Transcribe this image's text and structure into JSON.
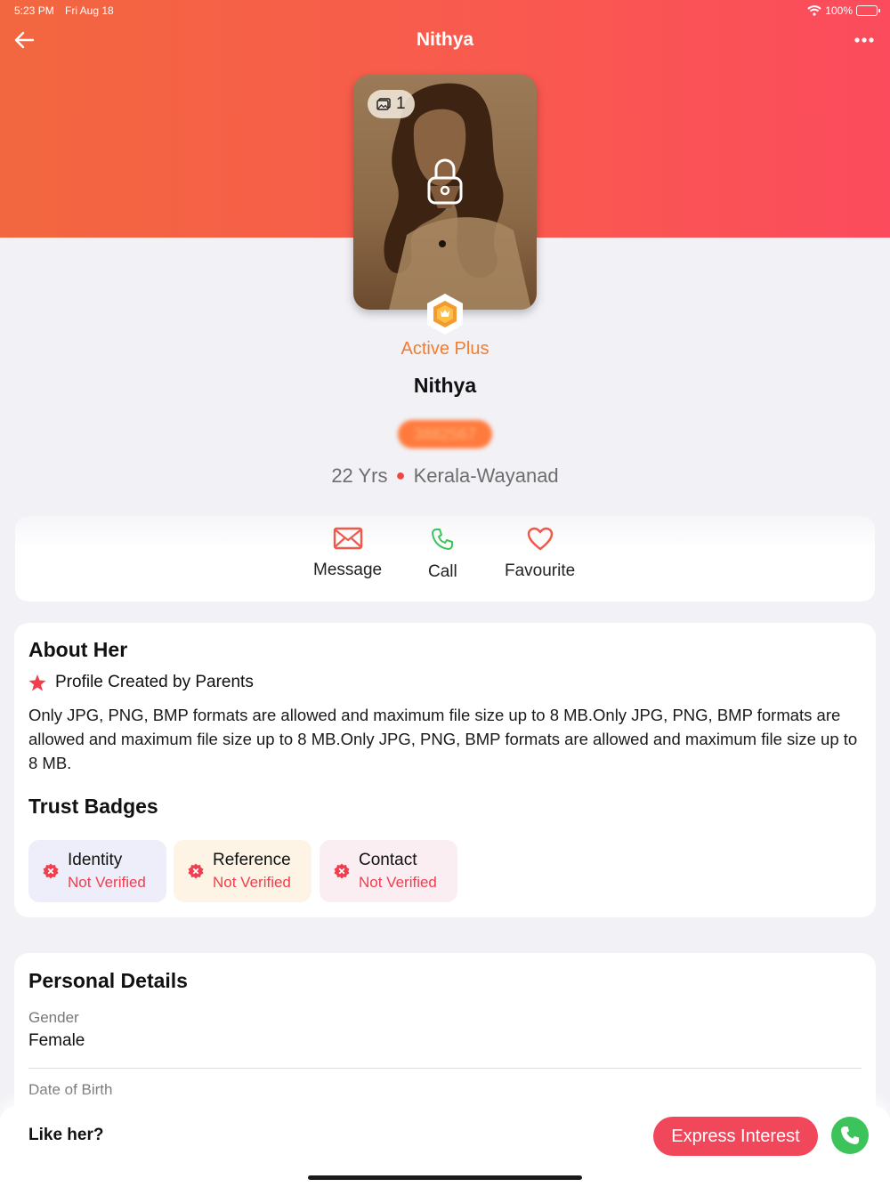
{
  "status_bar": {
    "time": "5:23 PM",
    "date": "Fri Aug 18",
    "battery": "100%"
  },
  "nav": {
    "title": "Nithya",
    "back_icon": "arrow-left-icon",
    "more_icon": "ellipsis-icon"
  },
  "profile": {
    "photo_count": "1",
    "plan": "Active Plus",
    "name": "Nithya",
    "profile_id": "3882567",
    "age": "22 Yrs",
    "location": "Kerala-Wayanad"
  },
  "actions": [
    {
      "label": "Message",
      "icon": "envelope-icon",
      "color": "#f0584a"
    },
    {
      "label": "Call",
      "icon": "phone-icon",
      "color": "#3cc45a"
    },
    {
      "label": "Favourite",
      "icon": "heart-icon",
      "color": "#f0584a"
    }
  ],
  "about": {
    "title": "About Her",
    "created_by": "Profile Created by Parents",
    "text": "Only JPG, PNG, BMP formats are allowed and maximum file size up to 8 MB.Only JPG, PNG, BMP formats are allowed and maximum file size up to 8 MB.Only JPG, PNG, BMP formats are allowed and maximum file size up to 8 MB."
  },
  "trust_badges": {
    "title": "Trust Badges",
    "items": [
      {
        "name": "Identity",
        "status": "Not Verified",
        "bg": "#eeeefa"
      },
      {
        "name": "Reference",
        "status": "Not Verified",
        "bg": "#fdf4e6"
      },
      {
        "name": "Contact",
        "status": "Not Verified",
        "bg": "#fbeef3"
      }
    ]
  },
  "personal": {
    "title": "Personal Details",
    "fields": [
      {
        "label": "Gender",
        "value": "Female"
      },
      {
        "label": "Date of Birth",
        "value": ""
      }
    ]
  },
  "bottom": {
    "prompt": "Like her?",
    "express_label": "Express Interest"
  },
  "colors": {
    "hero_start": "#f2673f",
    "hero_end": "#fb4b5d",
    "accent": "#f1475a",
    "plan": "#f47c2c",
    "call": "#3cc45a"
  }
}
